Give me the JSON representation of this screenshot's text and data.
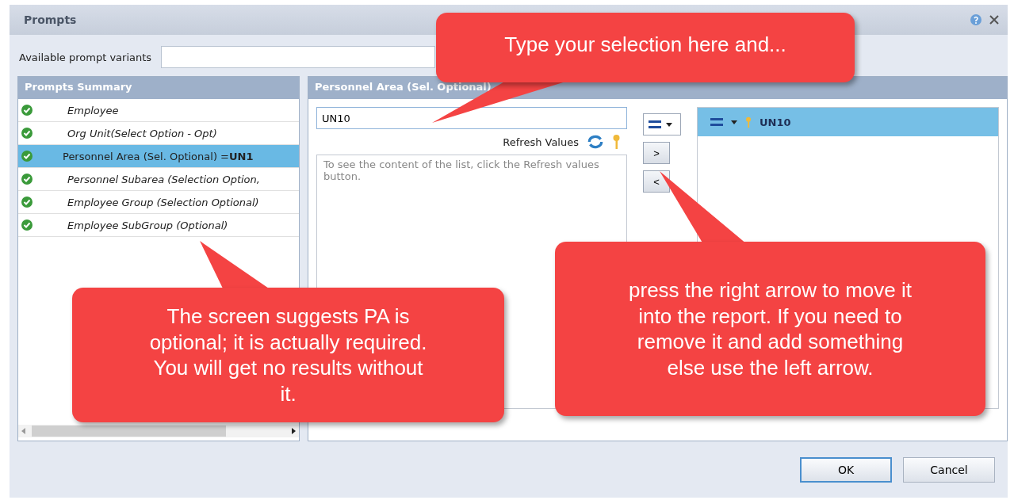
{
  "window": {
    "title": "Prompts"
  },
  "variants": {
    "label": "Available prompt variants"
  },
  "summary": {
    "title": "Prompts Summary",
    "items": [
      {
        "label": "Employee",
        "selected": false
      },
      {
        "label": "Org Unit(Select Option - Opt)",
        "selected": false
      },
      {
        "label": "Personnel Area (Sel. Optional) =**UN1**",
        "selected": true
      },
      {
        "label": "Personnel Subarea (Selection Option,",
        "selected": false
      },
      {
        "label": "Employee Group (Selection Optional)",
        "selected": false
      },
      {
        "label": "Employee SubGroup (Optional)",
        "selected": false
      }
    ]
  },
  "detail": {
    "title": "Personnel Area (Sel. Optional)",
    "input": "UN10",
    "refresh": "Refresh Values",
    "list_hint": "To see the content of the list, click the Refresh values button.",
    "add": ">",
    "remove": "<",
    "selected_values": [
      "UN10"
    ]
  },
  "callouts": [
    "Type your selection here and...",
    "The screen suggests PA is optional; it is actually required. You will get no results without it.",
    "press the right arrow to move it into the report. If you need to remove it and add something else use the left arrow."
  ],
  "buttons": [
    "OK",
    "Cancel"
  ]
}
